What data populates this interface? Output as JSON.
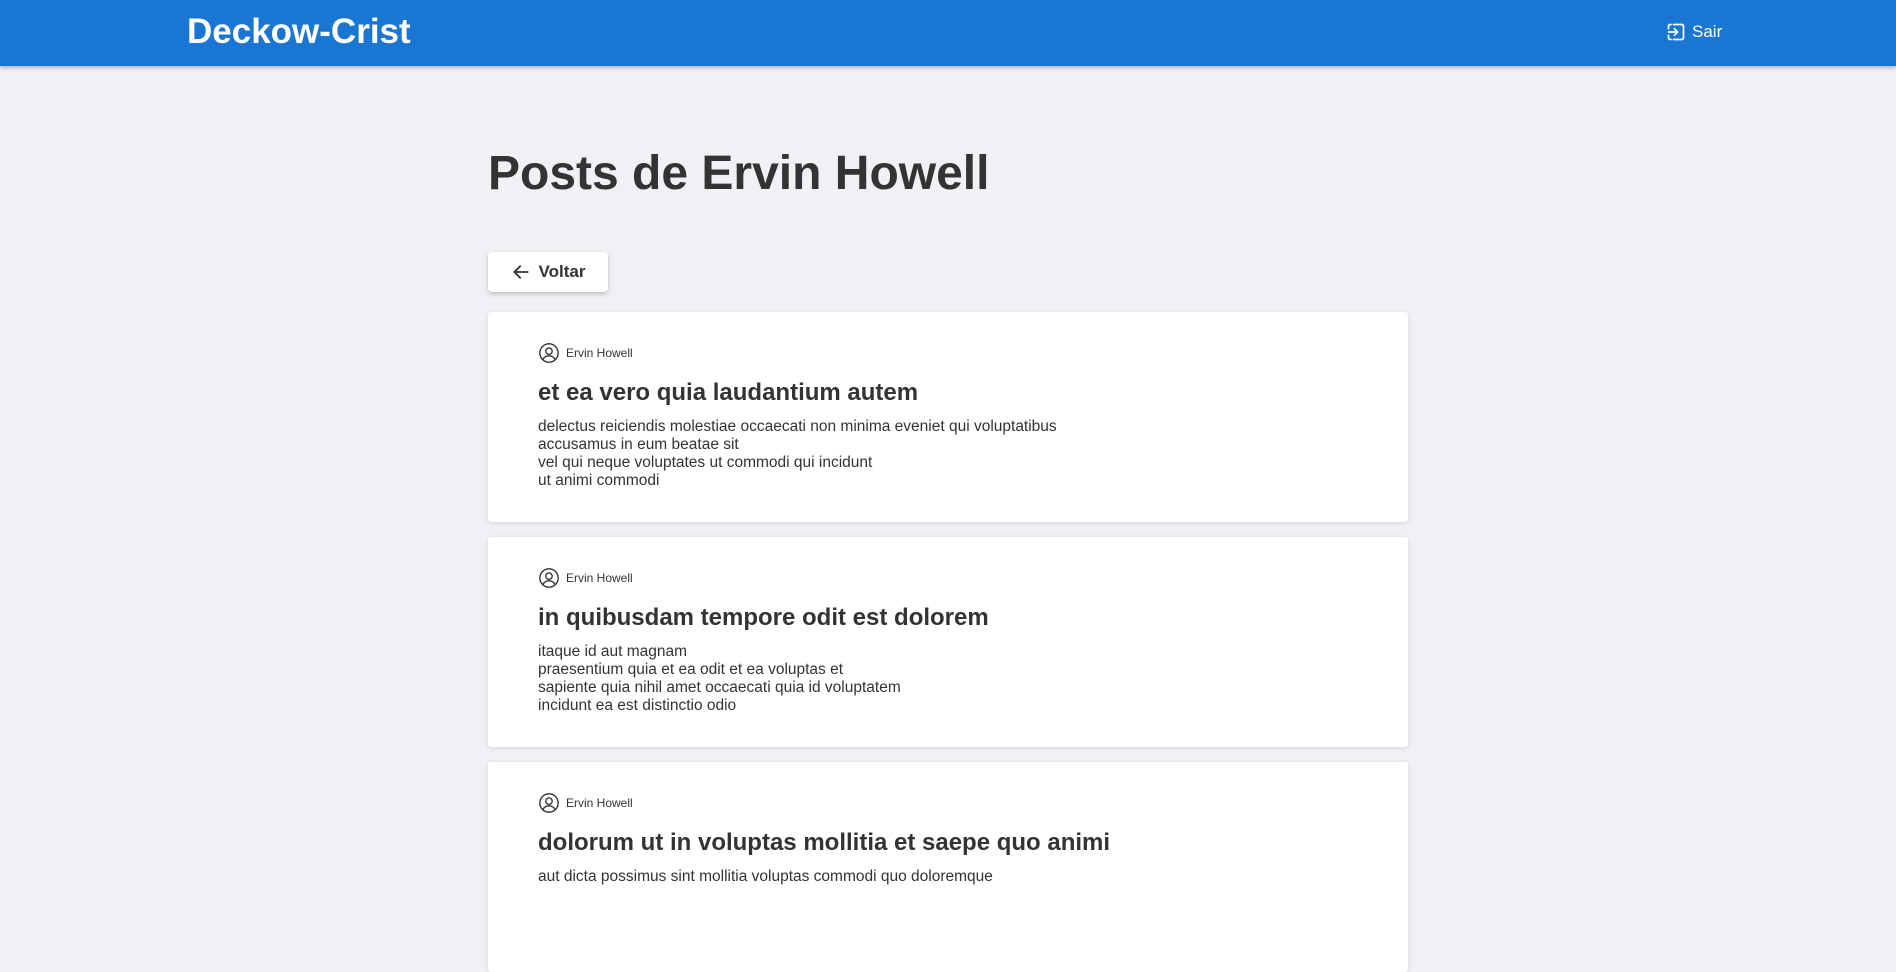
{
  "header": {
    "brand": "Deckow-Crist",
    "logout_label": "Sair",
    "logout_icon": "logout-icon",
    "background": "#1976d2"
  },
  "main": {
    "title": "Posts de Ervin Howell",
    "back_label": "Voltar",
    "back_icon": "arrow-left-icon"
  },
  "posts": [
    {
      "author": "Ervin Howell",
      "author_icon": "user-circle-icon",
      "title": "et ea vero quia laudantium autem",
      "body": "delectus reiciendis molestiae occaecati non minima eveniet qui voluptatibus\naccusamus in eum beatae sit\nvel qui neque voluptates ut commodi qui incidunt\nut animi commodi"
    },
    {
      "author": "Ervin Howell",
      "author_icon": "user-circle-icon",
      "title": "in quibusdam tempore odit est dolorem",
      "body": "itaque id aut magnam\npraesentium quia et ea odit et ea voluptas et\nsapiente quia nihil amet occaecati quia id voluptatem\nincidunt ea est distinctio odio"
    },
    {
      "author": "Ervin Howell",
      "author_icon": "user-circle-icon",
      "title": "dolorum ut in voluptas mollitia et saepe quo animi",
      "body": "aut dicta possimus sint mollitia voluptas commodi quo doloremque"
    }
  ]
}
